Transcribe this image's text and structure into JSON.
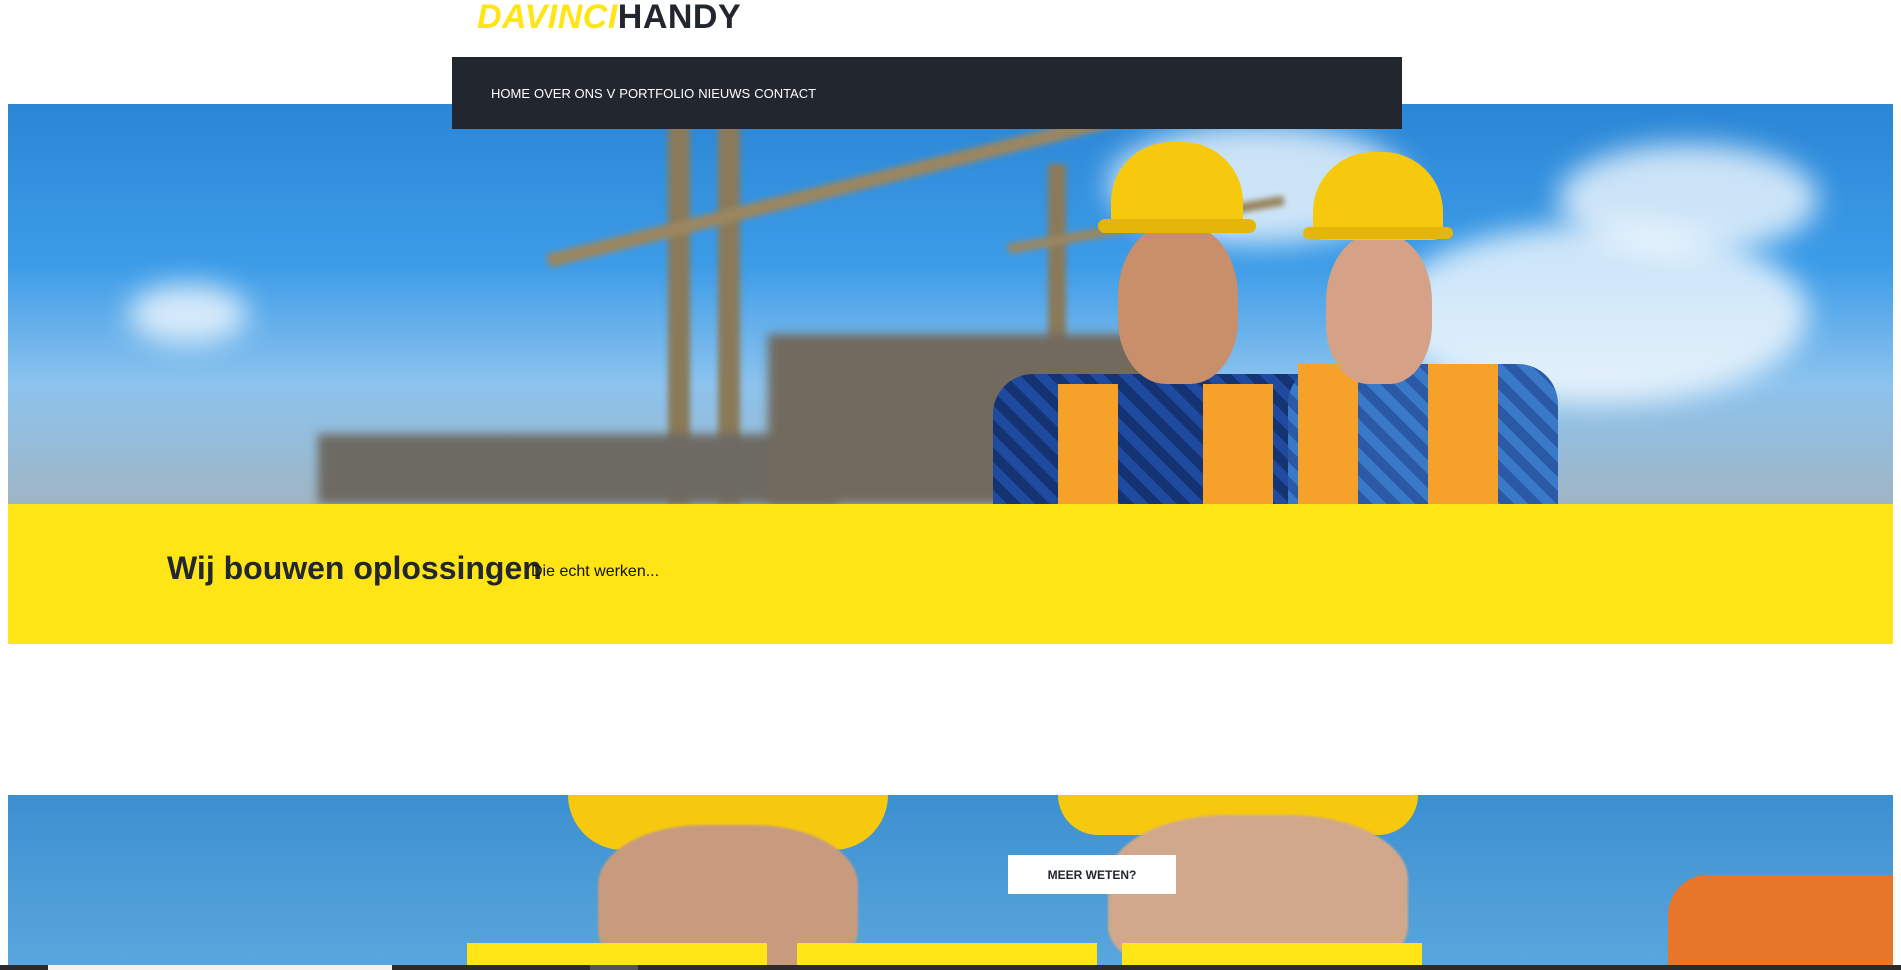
{
  "logo": {
    "part1": "DAVINCI",
    "part2": "HANDY"
  },
  "nav": {
    "items": [
      {
        "label": "HOME"
      },
      {
        "label": "OVER ONS"
      },
      {
        "label": "V"
      },
      {
        "label": "PORTFOLIO"
      },
      {
        "label": "NIEUWS"
      },
      {
        "label": "CONTACT"
      }
    ]
  },
  "band": {
    "title": "Wij bouwen oplossingen",
    "subtitle": "Die echt werken..."
  },
  "cta": {
    "label": "MEER WETEN?"
  },
  "colors": {
    "brand_yellow": "#ffe516",
    "dark": "#22262e"
  }
}
